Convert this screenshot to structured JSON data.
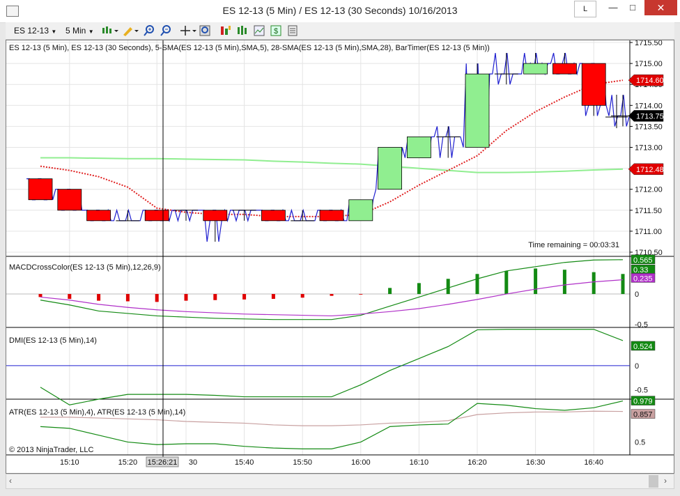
{
  "window": {
    "title": "ES 12-13 (5 Min) / ES 12-13 (30 Seconds)  10/16/2013",
    "l_button": "L",
    "minimize": "—",
    "maximize": "□",
    "close": "✕"
  },
  "toolbar": {
    "instrument": "ES 12-13",
    "interval": "5 Min",
    "icons": [
      "bar-type-icon",
      "pencil-draw-icon",
      "zoom-in-icon",
      "zoom-out-icon",
      "crosshair-icon",
      "magnifier-icon",
      "strategy-icon",
      "chart-style-icon",
      "data-box-icon",
      "dollar-icon",
      "properties-icon"
    ]
  },
  "colors": {
    "up_candle": "#90ee90",
    "down_candle": "#ff0000",
    "price_line": "#1f1fd0",
    "sma5": "#e02020",
    "sma28": "#90ee90",
    "macd_line": "#138a13",
    "macd_avg": "#b030c8",
    "atr_line": "#138a13",
    "atr_avg": "#c8a0a0"
  },
  "main_panel": {
    "label": "ES 12-13 (5 Min), ES 12-13 (30 Seconds), 5-SMA(ES 12-13 (5 Min),SMA,5), 28-SMA(ES 12-13 (5 Min),SMA,28), BarTimer(ES 12-13 (5 Min))",
    "y_ticks": [
      "1715.50",
      "1715.00",
      "1714.50",
      "1714.00",
      "1713.50",
      "1713.00",
      "1712.50",
      "1712.00",
      "1711.50",
      "1711.00",
      "1710.50"
    ],
    "tags": {
      "top_price": "1714.60",
      "current": "1713.75",
      "sma": "1712.48"
    },
    "time_remaining": "Time remaining = 00:03:31"
  },
  "macd_panel": {
    "label": "MACDCrossColor(ES 12-13 (5 Min),12,26,9)",
    "y_ticks": [
      "0",
      "-0.5"
    ],
    "tags": [
      "0.565",
      "0.33",
      "0.235"
    ]
  },
  "dmi_panel": {
    "label": "DMI(ES 12-13 (5 Min),14)",
    "y_ticks": [
      "0",
      "-0.5"
    ],
    "tag": "0.524"
  },
  "atr_panel": {
    "label": "ATR(ES 12-13 (5 Min),4), ATR(ES 12-13 (5 Min),14)",
    "y_ticks": [
      "0.5"
    ],
    "tags": [
      "0.979",
      "0.857"
    ],
    "copyright": "© 2013 NinjaTrader, LLC"
  },
  "x_axis": {
    "labels": [
      "15:10",
      "15:20",
      "15:26:21",
      "30",
      "15:40",
      "15:50",
      "16:00",
      "16:10",
      "16:20",
      "16:30",
      "16:40"
    ],
    "cursor_time": "15:26:21"
  },
  "chart_data": {
    "type": "candlestick",
    "interval": "5 Min",
    "times": [
      "15:05",
      "15:10",
      "15:15",
      "15:20",
      "15:25",
      "15:30",
      "15:35",
      "15:40",
      "15:45",
      "15:50",
      "15:55",
      "16:00",
      "16:05",
      "16:10",
      "16:15",
      "16:20",
      "16:25",
      "16:30",
      "16:35",
      "16:40",
      "16:45"
    ],
    "ohlc": [
      {
        "o": 1712.25,
        "h": 1712.25,
        "l": 1711.75,
        "c": 1711.75
      },
      {
        "o": 1712.0,
        "h": 1712.0,
        "l": 1711.5,
        "c": 1711.5
      },
      {
        "o": 1711.5,
        "h": 1711.5,
        "l": 1711.25,
        "c": 1711.25
      },
      {
        "o": 1711.25,
        "h": 1711.5,
        "l": 1711.25,
        "c": 1711.25
      },
      {
        "o": 1711.5,
        "h": 1711.5,
        "l": 1711.25,
        "c": 1711.25
      },
      {
        "o": 1711.5,
        "h": 1711.5,
        "l": 1711.25,
        "c": 1711.5
      },
      {
        "o": 1711.5,
        "h": 1711.5,
        "l": 1710.75,
        "c": 1711.25
      },
      {
        "o": 1711.5,
        "h": 1711.5,
        "l": 1711.25,
        "c": 1711.5
      },
      {
        "o": 1711.5,
        "h": 1711.5,
        "l": 1711.25,
        "c": 1711.25
      },
      {
        "o": 1711.25,
        "h": 1711.5,
        "l": 1711.25,
        "c": 1711.25
      },
      {
        "o": 1711.5,
        "h": 1711.5,
        "l": 1711.25,
        "c": 1711.25
      },
      {
        "o": 1711.25,
        "h": 1711.75,
        "l": 1711.25,
        "c": 1711.75
      },
      {
        "o": 1712.0,
        "h": 1713.0,
        "l": 1712.0,
        "c": 1713.0
      },
      {
        "o": 1712.75,
        "h": 1713.25,
        "l": 1712.75,
        "c": 1713.25
      },
      {
        "o": 1713.25,
        "h": 1713.5,
        "l": 1712.75,
        "c": 1713.25
      },
      {
        "o": 1713.0,
        "h": 1715.0,
        "l": 1713.0,
        "c": 1714.75
      },
      {
        "o": 1714.75,
        "h": 1715.25,
        "l": 1714.5,
        "c": 1714.75
      },
      {
        "o": 1714.75,
        "h": 1715.25,
        "l": 1714.75,
        "c": 1715.0
      },
      {
        "o": 1715.0,
        "h": 1715.25,
        "l": 1714.75,
        "c": 1714.75
      },
      {
        "o": 1715.0,
        "h": 1715.0,
        "l": 1713.75,
        "c": 1714.0
      },
      {
        "o": 1713.75,
        "h": 1714.25,
        "l": 1713.5,
        "c": 1713.75
      }
    ],
    "sma28": [
      1712.75,
      1712.75,
      1712.74,
      1712.73,
      1712.73,
      1712.72,
      1712.71,
      1712.7,
      1712.67,
      1712.65,
      1712.62,
      1712.6,
      1712.55,
      1712.5,
      1712.45,
      1712.4,
      1712.4,
      1712.41,
      1712.43,
      1712.46,
      1712.48
    ],
    "sma5": [
      1712.55,
      1712.45,
      1712.3,
      1712.05,
      1711.55,
      1711.45,
      1711.4,
      1711.4,
      1711.35,
      1711.35,
      1711.35,
      1711.4,
      1711.7,
      1712.1,
      1712.45,
      1712.8,
      1713.4,
      1713.85,
      1714.2,
      1714.5,
      1714.6
    ],
    "macd_histogram": [
      -0.05,
      -0.08,
      -0.11,
      -0.12,
      -0.13,
      -0.11,
      -0.1,
      -0.09,
      -0.08,
      -0.06,
      -0.03,
      -0.01,
      0.1,
      0.18,
      0.25,
      0.33,
      0.38,
      0.42,
      0.4,
      0.36,
      0.33
    ],
    "macd_line": [
      -0.1,
      -0.18,
      -0.28,
      -0.32,
      -0.36,
      -0.38,
      -0.4,
      -0.41,
      -0.42,
      -0.42,
      -0.42,
      -0.35,
      -0.2,
      -0.05,
      0.1,
      0.25,
      0.38,
      0.45,
      0.52,
      0.56,
      0.565
    ],
    "macd_avg": [
      -0.05,
      -0.1,
      -0.17,
      -0.22,
      -0.26,
      -0.29,
      -0.31,
      -0.33,
      -0.34,
      -0.35,
      -0.36,
      -0.33,
      -0.29,
      -0.24,
      -0.17,
      -0.09,
      0.0,
      0.08,
      0.15,
      0.2,
      0.235
    ],
    "dmi": [
      -0.45,
      -0.82,
      -0.7,
      -0.6,
      -0.6,
      -0.6,
      -0.62,
      -0.65,
      -0.65,
      -0.65,
      -0.65,
      -0.4,
      -0.1,
      0.15,
      0.4,
      0.75,
      0.76,
      0.76,
      0.76,
      0.76,
      0.524
    ],
    "atr4": [
      0.68,
      0.66,
      0.58,
      0.5,
      0.47,
      0.48,
      0.48,
      0.45,
      0.43,
      0.42,
      0.42,
      0.5,
      0.68,
      0.7,
      0.71,
      0.95,
      0.93,
      0.89,
      0.87,
      0.9,
      0.979
    ],
    "atr14": [
      0.79,
      0.79,
      0.78,
      0.77,
      0.76,
      0.74,
      0.73,
      0.72,
      0.7,
      0.69,
      0.69,
      0.7,
      0.72,
      0.73,
      0.75,
      0.82,
      0.84,
      0.85,
      0.85,
      0.86,
      0.857
    ]
  }
}
